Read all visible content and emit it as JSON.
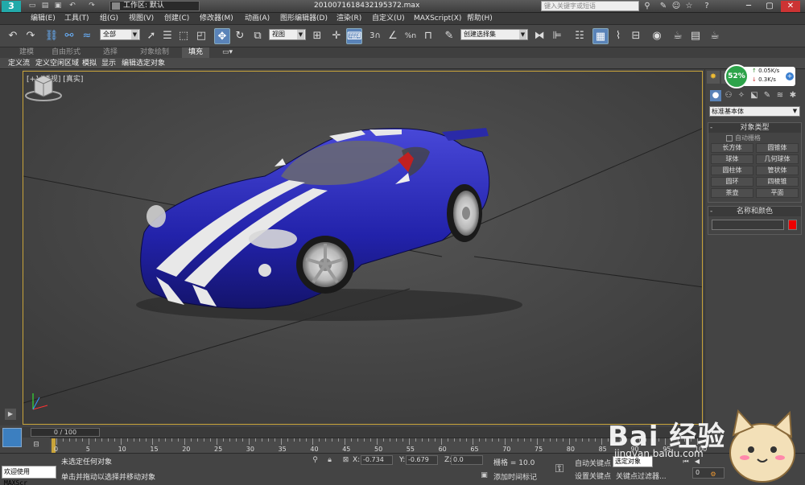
{
  "titlebar": {
    "workspace_label": "工作区: 默认",
    "file_name": "2010071618432195372.max",
    "search_placeholder": "键入关键字或短语"
  },
  "menu": [
    "编辑(E)",
    "工具(T)",
    "组(G)",
    "视图(V)",
    "创建(C)",
    "修改器(M)",
    "动画(A)",
    "图形编辑器(D)",
    "渲染(R)",
    "自定义(U)",
    "MAXScript(X)",
    "帮助(H)"
  ],
  "toolbar": {
    "selection_filter": "全部",
    "reference_coord": "视图",
    "named_selection": "创建选择集",
    "snap_label": "3",
    "percent_snap": "%n"
  },
  "ribbon": {
    "tabs": [
      "建模",
      "自由形式",
      "选择",
      "对象绘制",
      "填充"
    ],
    "active_tab": "填充",
    "subtabs": [
      "定义流",
      "定义空闲区域",
      "模拟",
      "显示",
      "编辑选定对象"
    ]
  },
  "viewport": {
    "label": "[+] [透视] [真实]",
    "frame_color": "#c9a43a"
  },
  "command_panel": {
    "dropdown": "标准基本体",
    "object_type": {
      "header": "对象类型",
      "autogrid": "自动栅格",
      "buttons": [
        "长方体",
        "圆锥体",
        "球体",
        "几何球体",
        "圆柱体",
        "管状体",
        "圆环",
        "四棱锥",
        "茶壶",
        "平面"
      ]
    },
    "name_color": {
      "header": "名称和颜色",
      "swatch": "#e00000"
    }
  },
  "net_widget": {
    "percent": "52%",
    "upload": "0.05K/s",
    "download": "0.3K/s"
  },
  "timeline": {
    "slider_label": "0 / 100",
    "ticks": [
      "0",
      "5",
      "10",
      "15",
      "20",
      "25",
      "30",
      "35",
      "40",
      "45",
      "50",
      "55",
      "60",
      "65",
      "70",
      "75",
      "80",
      "85",
      "90",
      "95",
      "100"
    ]
  },
  "status": {
    "welcome": "欢迎使用 MAXScr",
    "line1": "未选定任何对象",
    "line2": "单击并拖动以选择并移动对象",
    "x_label": "X:",
    "x_value": "-0.734",
    "y_label": "Y:",
    "y_value": "-0.679",
    "z_label": "Z:",
    "z_value": "0.0",
    "grid": "栅格 = 10.0",
    "add_time_tag": "添加时间标记",
    "auto_key": "自动关键点",
    "set_key": "设置关键点",
    "selected_field": "选定对象",
    "key_filters": "关键点过滤器...",
    "frame": "0"
  },
  "watermark": {
    "brand": "Bai  经验",
    "url": "jingyan.baidu.com"
  }
}
